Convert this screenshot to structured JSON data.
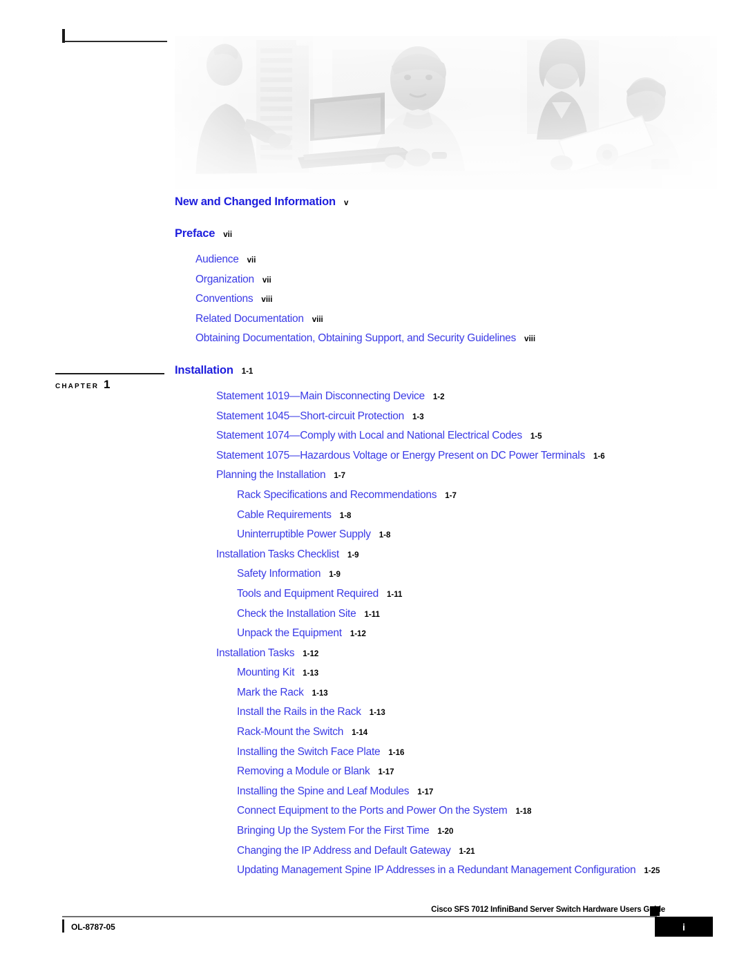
{
  "document": {
    "footer_title": "Cisco SFS 7012 InfiniBand Server Switch Hardware Users Guide",
    "footer_doc_number": "OL-8787-05",
    "footer_page_number": "i"
  },
  "banner": {
    "alt": "grayscale photo banner of people working with network equipment and laptops"
  },
  "chapter_marker": {
    "word": "CHAPTER",
    "number": "1"
  },
  "colors": {
    "heading_blue": "#1d1ddd",
    "entry_blue": "#3a3ae6",
    "page_number_black": "#000000"
  },
  "toc": {
    "sections": [
      {
        "heading": {
          "label": "New and Changed Information",
          "page": "v"
        },
        "entries": []
      },
      {
        "heading": {
          "label": "Preface",
          "page": "vii"
        },
        "entries": [
          {
            "level": 0,
            "label": "Audience",
            "page": "vii"
          },
          {
            "level": 0,
            "label": "Organization",
            "page": "vii"
          },
          {
            "level": 0,
            "label": "Conventions",
            "page": "viii"
          },
          {
            "level": 0,
            "label": "Related Documentation",
            "page": "viii"
          },
          {
            "level": 0,
            "label": "Obtaining Documentation, Obtaining Support, and Security Guidelines",
            "page": "viii"
          }
        ]
      },
      {
        "heading": {
          "label": "Installation",
          "page": "1-1"
        },
        "entries": [
          {
            "level": 1,
            "label": "Statement 1019—Main Disconnecting Device",
            "page": "1-2"
          },
          {
            "level": 1,
            "label": "Statement 1045—Short-circuit Protection",
            "page": "1-3"
          },
          {
            "level": 1,
            "label": "Statement 1074—Comply with Local and National Electrical Codes",
            "page": "1-5"
          },
          {
            "level": 1,
            "label": "Statement 1075—Hazardous Voltage or Energy Present on DC Power Terminals",
            "page": "1-6"
          },
          {
            "level": 1,
            "label": "Planning the Installation",
            "page": "1-7"
          },
          {
            "level": 2,
            "label": "Rack Specifications and Recommendations",
            "page": "1-7"
          },
          {
            "level": 2,
            "label": "Cable Requirements",
            "page": "1-8"
          },
          {
            "level": 2,
            "label": "Uninterruptible Power Supply",
            "page": "1-8"
          },
          {
            "level": 1,
            "label": "Installation Tasks Checklist",
            "page": "1-9"
          },
          {
            "level": 2,
            "label": "Safety Information",
            "page": "1-9"
          },
          {
            "level": 2,
            "label": "Tools and Equipment Required",
            "page": "1-11"
          },
          {
            "level": 2,
            "label": "Check the Installation Site",
            "page": "1-11"
          },
          {
            "level": 2,
            "label": "Unpack the Equipment",
            "page": "1-12"
          },
          {
            "level": 1,
            "label": "Installation Tasks",
            "page": "1-12"
          },
          {
            "level": 2,
            "label": "Mounting Kit",
            "page": "1-13"
          },
          {
            "level": 2,
            "label": "Mark the Rack",
            "page": "1-13"
          },
          {
            "level": 2,
            "label": "Install the Rails in the Rack",
            "page": "1-13"
          },
          {
            "level": 2,
            "label": "Rack-Mount the Switch",
            "page": "1-14"
          },
          {
            "level": 2,
            "label": "Installing the Switch Face Plate",
            "page": "1-16"
          },
          {
            "level": 2,
            "label": "Removing a Module or Blank",
            "page": "1-17"
          },
          {
            "level": 2,
            "label": "Installing the Spine and Leaf Modules",
            "page": "1-17"
          },
          {
            "level": 2,
            "label": "Connect Equipment to the Ports and Power On the System",
            "page": "1-18"
          },
          {
            "level": 2,
            "label": "Bringing Up the System For the First Time",
            "page": "1-20"
          },
          {
            "level": 2,
            "label": "Changing the IP Address and Default Gateway",
            "page": "1-21"
          },
          {
            "level": 2,
            "label": "Updating Management Spine IP Addresses in a Redundant Management Configuration",
            "page": "1-25"
          }
        ]
      }
    ]
  }
}
